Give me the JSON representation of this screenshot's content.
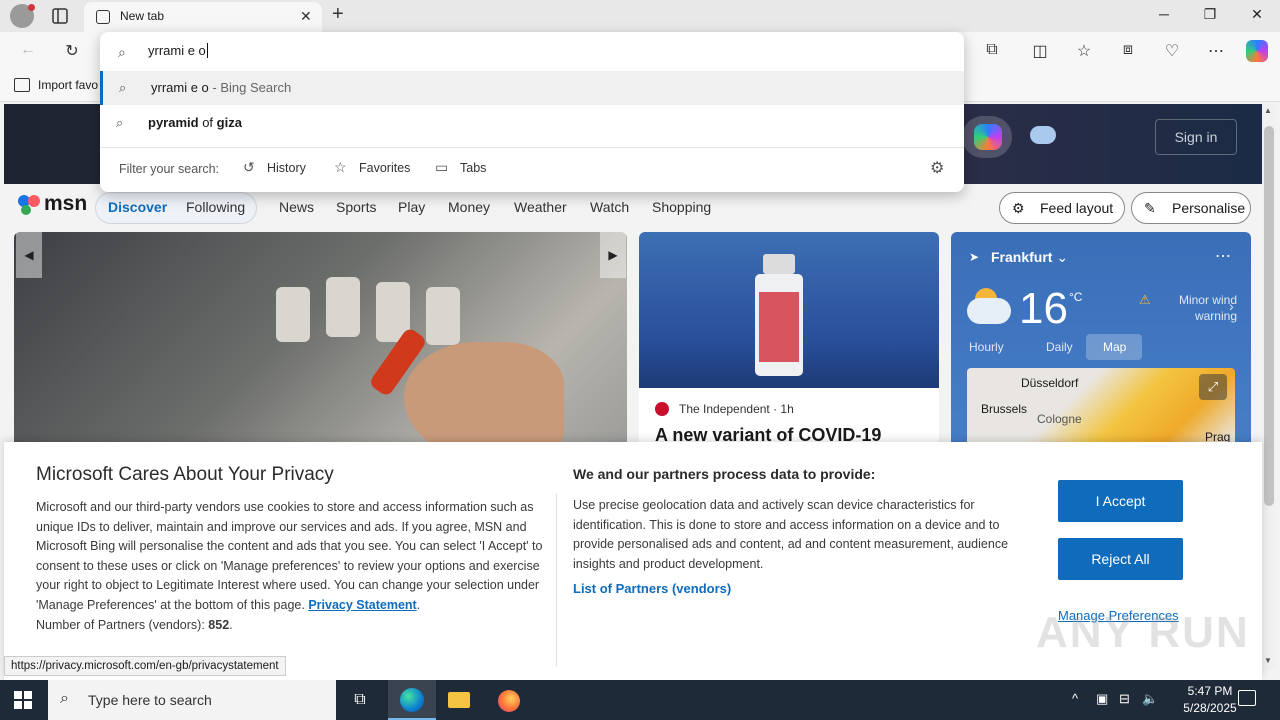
{
  "browser": {
    "tab_title": "New tab",
    "tab_close": "✕",
    "new_tab": "+",
    "window_controls": {
      "minimize": "─",
      "restore": "❐",
      "close": "✕"
    },
    "bookmarks_bar": {
      "import_label": "Import favo"
    },
    "toolbar_icons": [
      "back-icon",
      "refresh-icon",
      "extensions-icon",
      "split-screen-icon",
      "favorites-icon",
      "collections-icon",
      "browser-essentials-icon",
      "more-icon",
      "copilot-icon"
    ],
    "accent": "#0f6cbd"
  },
  "omnibox": {
    "input": "yrrami e o",
    "suggestions": [
      {
        "text": "yrrami e o",
        "suffix": " - Bing Search",
        "icon": "search-icon"
      },
      {
        "text_bold": "pyramid",
        "text_mid": " of ",
        "text_bold2": "giza",
        "icon": "search-icon"
      }
    ],
    "filter_label": "Filter your search:",
    "filters": [
      "History",
      "Favorites",
      "Tabs"
    ]
  },
  "msn": {
    "logo_text": "msn",
    "sign_in": "Sign in",
    "nav": [
      "Discover",
      "Following",
      "News",
      "Sports",
      "Play",
      "Money",
      "Weather",
      "Watch",
      "Shopping"
    ],
    "feed_layout": "Feed layout",
    "personalise": "Personalise",
    "news_card": {
      "source": "The Independent",
      "time": "· 1h",
      "headline": "A new variant of COVID-19"
    },
    "weather": {
      "location": "Frankfurt",
      "temperature": "16",
      "unit": "°C",
      "warning": "Minor wind warning",
      "tabs": [
        "Hourly",
        "Daily",
        "Map"
      ],
      "cities": [
        "Düsseldorf",
        "Brussels",
        "Cologne",
        "Prag"
      ]
    }
  },
  "privacy": {
    "title": "Microsoft Cares About Your Privacy",
    "body": "Microsoft and our third-party vendors use cookies to store and access information such as unique IDs to deliver, maintain and improve our services and ads. If you agree, MSN and Microsoft Bing will personalise the content and ads that you see. You can select 'I Accept' to consent to these uses or click on 'Manage preferences' to review your options and exercise your right to object to Legitimate Interest where used.  You can change your selection under 'Manage Preferences' at the bottom of this page.",
    "privacy_link": "Privacy Statement",
    "partners_count_label": "Number of Partners (vendors):",
    "partners_count": "852",
    "right_title": "We and our partners process data to provide:",
    "right_body": "Use precise geolocation data and actively scan device characteristics for identification. This is done to store and access information on a device and to provide personalised ads and content, ad and content measurement, audience insights and product development.",
    "partners_link": "List of Partners (vendors)",
    "accept": "I Accept",
    "reject": "Reject All",
    "manage": "Manage Preferences",
    "status_url": "https://privacy.microsoft.com/en-gb/privacystatement"
  },
  "watermark": "ANY RUN",
  "taskbar": {
    "search_placeholder": "Type here to search",
    "time": "5:47 PM",
    "date": "5/28/2025"
  }
}
